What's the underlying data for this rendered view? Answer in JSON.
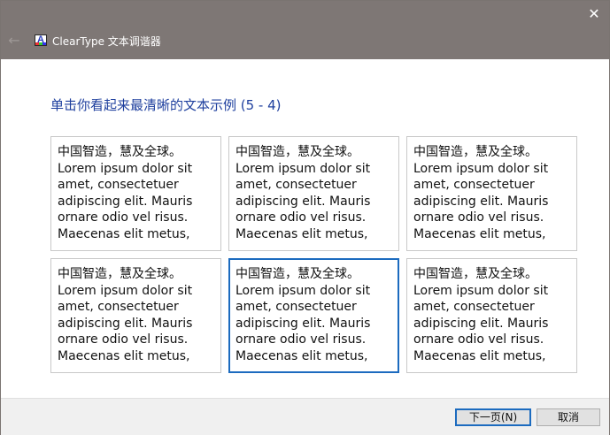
{
  "window": {
    "title": "ClearType 文本调谐器",
    "close_glyph": "✕",
    "back_glyph": "←",
    "icon_letter": "A"
  },
  "main": {
    "heading": "单击你看起来最清晰的文本示例 (5 - 4)"
  },
  "samples": [
    {
      "text": "中国智造，慧及全球。\nLorem ipsum dolor sit\namet, consectetuer\nadipiscing elit. Mauris\nornare odio vel risus.\nMaecenas elit metus,"
    },
    {
      "text": "中国智造，慧及全球。\nLorem ipsum dolor sit\namet, consectetuer\nadipiscing elit. Mauris\nornare odio vel risus.\nMaecenas elit metus,"
    },
    {
      "text": "中国智造，慧及全球。\nLorem ipsum dolor sit\namet, consectetuer\nadipiscing elit. Mauris\nornare odio vel risus.\nMaecenas elit metus,"
    },
    {
      "text": "中国智造，慧及全球。\nLorem ipsum dolor sit\namet, consectetuer\nadipiscing elit. Mauris\nornare odio vel risus.\nMaecenas elit metus,"
    },
    {
      "text": "中国智造，慧及全球。\nLorem ipsum dolor sit\namet, consectetuer\nadipiscing elit. Mauris\nornare odio vel risus.\nMaecenas elit metus,"
    },
    {
      "text": "中国智造，慧及全球。\nLorem ipsum dolor sit\namet, consectetuer\nadipiscing elit. Mauris\nornare odio vel risus.\nMaecenas elit metus,"
    }
  ],
  "selected_sample": 5,
  "footer": {
    "next_label": "下一页(N)",
    "cancel_label": "取消"
  },
  "colors": {
    "titlebar": "#7e7775",
    "heading": "#1e3f9e",
    "selection_border": "#1c6bbf"
  }
}
